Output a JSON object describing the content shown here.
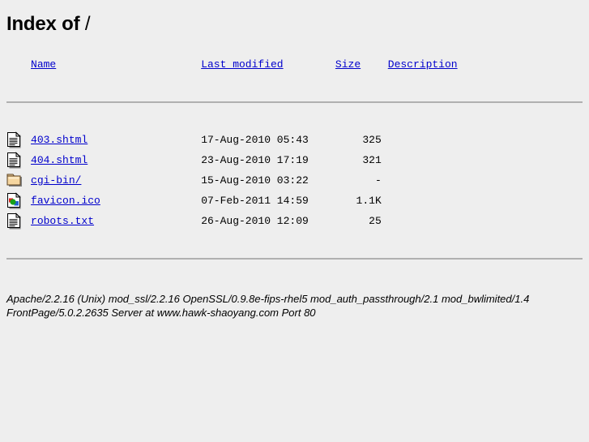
{
  "title": {
    "prefix": "Index of",
    "path": "/"
  },
  "columns": {
    "name": "Name",
    "last_modified": "Last modified",
    "size": "Size",
    "description": "Description"
  },
  "colors": {
    "link": "#0000cc",
    "background": "#eeeeee",
    "rule": "#b0b0b0",
    "folder": "#f5d6a0",
    "folder_edge": "#c8a055"
  },
  "entries": [
    {
      "icon": "text-file-icon",
      "name": "403.shtml",
      "last_modified": "17-Aug-2010 05:43",
      "size": "325",
      "description": ""
    },
    {
      "icon": "text-file-icon",
      "name": "404.shtml",
      "last_modified": "23-Aug-2010 17:19",
      "size": "321",
      "description": ""
    },
    {
      "icon": "folder-icon",
      "name": "cgi-bin/",
      "last_modified": "15-Aug-2010 03:22",
      "size": "-",
      "description": ""
    },
    {
      "icon": "image-file-icon",
      "name": "favicon.ico",
      "last_modified": "07-Feb-2011 14:59",
      "size": "1.1K",
      "description": ""
    },
    {
      "icon": "text-file-icon",
      "name": "robots.txt",
      "last_modified": "26-Aug-2010 12:09",
      "size": "25",
      "description": ""
    }
  ],
  "signature": {
    "line1": "Apache/2.2.16 (Unix) mod_ssl/2.2.16 OpenSSL/0.9.8e-fips-rhel5 mod_auth_passthrough/2.1 mod_bwlimited/1.4",
    "line2": "FrontPage/5.0.2.2635 Server at www.hawk-shaoyang.com Port 80"
  }
}
